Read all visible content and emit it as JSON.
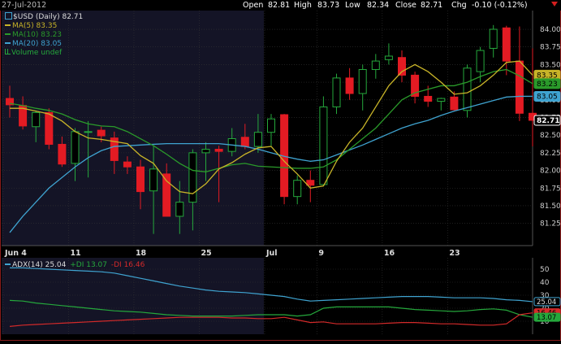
{
  "header": {
    "date": "27-Jul-2012",
    "open_label": "Open",
    "open": "82.81",
    "high_label": "High",
    "high": "83.73",
    "low_label": "Low",
    "low": "82.34",
    "close_label": "Close",
    "close": "82.71",
    "chg_label": "Chg",
    "chg": "-0.10 (-0.12%)"
  },
  "legend": {
    "symbol": "$USD (Daily) 82.71",
    "ma5": "MA(5) 83.35",
    "ma10": "MA(10) 83.23",
    "ma20": "MA(20) 83.05",
    "volume": "Volume undef"
  },
  "adx_legend": {
    "adx": "ADX(14) 25.04",
    "pdi": "+DI 13.07",
    "mdi": "-DI 16.46"
  },
  "colors": {
    "up": "#25a83c",
    "down": "#e31b23",
    "ma5": "#c8b428",
    "ma10": "#2a9a2a",
    "ma20": "#3fa3d0",
    "adx": "#3fa3d0",
    "pdi": "#25a83c",
    "mdi": "#d42a2a",
    "grid": "#333333",
    "panel": "#141426"
  },
  "chart_data": [
    {
      "type": "candlestick",
      "title": "$USD (Daily)",
      "ylim": [
        81.05,
        84.15
      ],
      "yticks": [
        "84.00",
        "83.75",
        "83.50",
        "83.25",
        "83.00",
        "82.75",
        "82.50",
        "82.25",
        "82.00",
        "81.75",
        "81.50",
        "81.25"
      ],
      "xticks": [
        {
          "label": "Jun 4",
          "idx": 0
        },
        {
          "label": "11",
          "idx": 5
        },
        {
          "label": "18",
          "idx": 10
        },
        {
          "label": "25",
          "idx": 15
        },
        {
          "label": "Jul",
          "idx": 20
        },
        {
          "label": "9",
          "idx": 24
        },
        {
          "label": "16",
          "idx": 29
        },
        {
          "label": "23",
          "idx": 34
        }
      ],
      "candles": [
        {
          "o": 83.02,
          "h": 83.2,
          "l": 82.75,
          "c": 82.93
        },
        {
          "o": 82.92,
          "h": 83.05,
          "l": 82.58,
          "c": 82.63
        },
        {
          "o": 82.62,
          "h": 82.85,
          "l": 82.4,
          "c": 82.82
        },
        {
          "o": 82.82,
          "h": 82.88,
          "l": 82.3,
          "c": 82.37
        },
        {
          "o": 82.37,
          "h": 82.48,
          "l": 82.05,
          "c": 82.09
        },
        {
          "o": 82.1,
          "h": 82.6,
          "l": 81.85,
          "c": 82.55
        },
        {
          "o": 82.55,
          "h": 82.7,
          "l": 81.9,
          "c": 82.55
        },
        {
          "o": 82.57,
          "h": 82.62,
          "l": 82.4,
          "c": 82.49
        },
        {
          "o": 82.46,
          "h": 82.55,
          "l": 81.95,
          "c": 82.14
        },
        {
          "o": 82.12,
          "h": 82.2,
          "l": 81.95,
          "c": 82.05
        },
        {
          "o": 82.05,
          "h": 82.15,
          "l": 81.45,
          "c": 81.7
        },
        {
          "o": 81.71,
          "h": 82.35,
          "l": 81.1,
          "c": 82.02
        },
        {
          "o": 81.95,
          "h": 82.1,
          "l": 81.52,
          "c": 81.35
        },
        {
          "o": 81.35,
          "h": 81.85,
          "l": 81.1,
          "c": 81.55
        },
        {
          "o": 81.55,
          "h": 82.3,
          "l": 81.15,
          "c": 82.25
        },
        {
          "o": 82.25,
          "h": 82.4,
          "l": 81.85,
          "c": 82.3
        },
        {
          "o": 82.3,
          "h": 82.35,
          "l": 81.55,
          "c": 82.27
        },
        {
          "o": 82.27,
          "h": 82.6,
          "l": 82.2,
          "c": 82.45
        },
        {
          "o": 82.47,
          "h": 82.66,
          "l": 82.3,
          "c": 82.34
        },
        {
          "o": 82.34,
          "h": 82.8,
          "l": 82.25,
          "c": 82.54
        },
        {
          "o": 82.54,
          "h": 82.8,
          "l": 82.35,
          "c": 82.73
        },
        {
          "o": 82.79,
          "h": 82.8,
          "l": 81.52,
          "c": 81.63
        },
        {
          "o": 81.63,
          "h": 81.93,
          "l": 81.52,
          "c": 81.86
        },
        {
          "o": 81.86,
          "h": 82.0,
          "l": 81.55,
          "c": 81.79
        },
        {
          "o": 81.8,
          "h": 83.05,
          "l": 81.78,
          "c": 82.9
        },
        {
          "o": 82.9,
          "h": 83.37,
          "l": 82.8,
          "c": 83.31
        },
        {
          "o": 83.31,
          "h": 83.45,
          "l": 83.0,
          "c": 83.09
        },
        {
          "o": 83.09,
          "h": 83.5,
          "l": 82.85,
          "c": 83.43
        },
        {
          "o": 83.43,
          "h": 83.65,
          "l": 83.3,
          "c": 83.55
        },
        {
          "o": 83.57,
          "h": 83.8,
          "l": 83.5,
          "c": 83.62
        },
        {
          "o": 83.6,
          "h": 83.7,
          "l": 83.25,
          "c": 83.35
        },
        {
          "o": 83.35,
          "h": 83.4,
          "l": 82.95,
          "c": 83.05
        },
        {
          "o": 83.05,
          "h": 83.2,
          "l": 82.9,
          "c": 82.98
        },
        {
          "o": 82.98,
          "h": 83.03,
          "l": 82.85,
          "c": 83.02
        },
        {
          "o": 83.04,
          "h": 83.12,
          "l": 82.85,
          "c": 82.86
        },
        {
          "o": 82.85,
          "h": 83.5,
          "l": 82.75,
          "c": 83.45
        },
        {
          "o": 83.4,
          "h": 83.75,
          "l": 83.25,
          "c": 83.7
        },
        {
          "o": 83.73,
          "h": 84.06,
          "l": 83.6,
          "c": 84.0
        },
        {
          "o": 84.02,
          "h": 84.05,
          "l": 83.35,
          "c": 83.55
        },
        {
          "o": 83.55,
          "h": 84.04,
          "l": 82.7,
          "c": 82.81
        },
        {
          "o": 82.81,
          "h": 83.73,
          "l": 82.34,
          "c": 82.71
        }
      ],
      "ma5": [
        82.88,
        82.88,
        82.84,
        82.8,
        82.7,
        82.55,
        82.46,
        82.44,
        82.41,
        82.38,
        82.21,
        82.1,
        81.85,
        81.7,
        81.67,
        81.81,
        82.02,
        82.11,
        82.23,
        82.32,
        82.34,
        82.13,
        81.95,
        81.75,
        81.78,
        82.13,
        82.4,
        82.6,
        82.9,
        83.2,
        83.4,
        83.5,
        83.4,
        83.25,
        83.08,
        83.1,
        83.2,
        83.35,
        83.53,
        83.55,
        83.35
      ],
      "ma10": [
        82.95,
        82.92,
        82.88,
        82.85,
        82.8,
        82.72,
        82.66,
        82.63,
        82.62,
        82.55,
        82.45,
        82.35,
        82.23,
        82.1,
        82.0,
        81.98,
        82.03,
        82.08,
        82.1,
        82.06,
        82.05,
        82.04,
        82.03,
        82.03,
        82.05,
        82.15,
        82.3,
        82.45,
        82.6,
        82.8,
        83.0,
        83.1,
        83.15,
        83.2,
        83.2,
        83.25,
        83.33,
        83.4,
        83.43,
        83.34,
        83.23
      ],
      "ma20": [
        81.12,
        81.35,
        81.55,
        81.75,
        81.9,
        82.05,
        82.18,
        82.28,
        82.34,
        82.35,
        82.36,
        82.37,
        82.38,
        82.38,
        82.38,
        82.38,
        82.38,
        82.36,
        82.34,
        82.3,
        82.25,
        82.2,
        82.16,
        82.13,
        82.15,
        82.22,
        82.29,
        82.36,
        82.44,
        82.52,
        82.6,
        82.66,
        82.71,
        82.78,
        82.84,
        82.89,
        82.94,
        82.99,
        83.04,
        83.05,
        83.05
      ]
    },
    {
      "type": "line",
      "title": "ADX(14)",
      "ylim": [
        0,
        55
      ],
      "yticks": [
        "50",
        "40",
        "30",
        "20",
        "10"
      ],
      "series": [
        {
          "name": "ADX(14)",
          "values": [
            51,
            51,
            50.5,
            50,
            49.5,
            49,
            48.5,
            48,
            47,
            45,
            43,
            41,
            39,
            37,
            35.5,
            34,
            33,
            32.5,
            32,
            31,
            30,
            29,
            27,
            25.5,
            26,
            26.5,
            27,
            27.5,
            28,
            28.5,
            29,
            29,
            29,
            28.5,
            28,
            28,
            28,
            27.5,
            26.5,
            26,
            25.04
          ]
        },
        {
          "name": "+DI",
          "values": [
            26,
            25.5,
            24,
            23,
            22,
            21,
            20,
            19,
            18,
            17.5,
            17,
            16,
            15,
            14.5,
            14,
            14,
            14,
            14,
            14.5,
            15,
            15,
            15,
            14,
            15,
            20,
            21,
            21,
            21,
            21,
            21,
            20,
            19,
            18.5,
            18,
            17.5,
            18,
            19,
            19.5,
            18.5,
            15,
            13.07
          ]
        },
        {
          "name": "-DI",
          "values": [
            6,
            7,
            7.5,
            8,
            8.5,
            9,
            9.5,
            10,
            10.5,
            11,
            11.5,
            12,
            12.5,
            13,
            13,
            13,
            13,
            12.5,
            12.5,
            12,
            12,
            13,
            11,
            9,
            9.5,
            8,
            8,
            8,
            8,
            8.5,
            9,
            9,
            8.5,
            8,
            8,
            7.5,
            7,
            7,
            8,
            15,
            16.46
          ]
        }
      ]
    }
  ]
}
